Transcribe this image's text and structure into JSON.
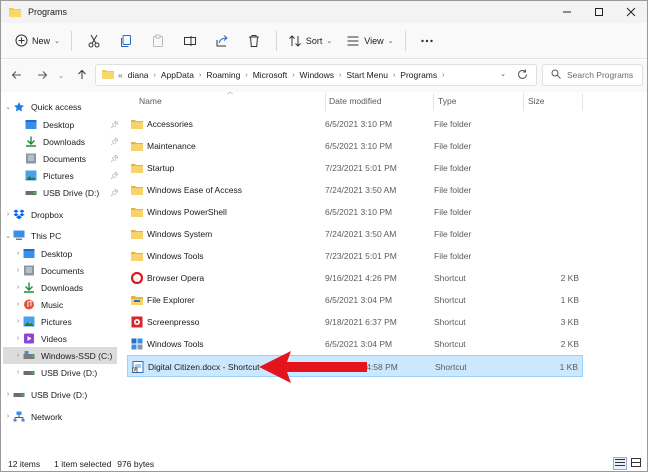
{
  "window": {
    "title": "Programs"
  },
  "toolbar": {
    "new_label": "New",
    "sort_label": "Sort",
    "view_label": "View",
    "more_icon": "ellipsis-icon",
    "icons": [
      "cut-icon",
      "copy-icon",
      "paste-icon",
      "rename-icon",
      "share-icon",
      "delete-icon"
    ]
  },
  "address": {
    "crumbs": [
      "diana",
      "AppData",
      "Roaming",
      "Microsoft",
      "Windows",
      "Start Menu",
      "Programs"
    ],
    "prefix": "«"
  },
  "search": {
    "placeholder": "Search Programs"
  },
  "nav": {
    "quick_access": "Quick access",
    "qa_items": [
      {
        "label": "Desktop",
        "icon": "desktop-icon",
        "pinned": true
      },
      {
        "label": "Downloads",
        "icon": "downloads-icon",
        "pinned": true
      },
      {
        "label": "Documents",
        "icon": "documents-icon",
        "pinned": true
      },
      {
        "label": "Pictures",
        "icon": "pictures-icon",
        "pinned": true
      },
      {
        "label": "USB Drive (D:)",
        "icon": "usb-drive-icon",
        "pinned": true
      }
    ],
    "dropbox": "Dropbox",
    "this_pc": "This PC",
    "pc_items": [
      {
        "label": "Desktop",
        "icon": "desktop-icon"
      },
      {
        "label": "Documents",
        "icon": "documents-icon"
      },
      {
        "label": "Downloads",
        "icon": "downloads-icon"
      },
      {
        "label": "Music",
        "icon": "music-icon"
      },
      {
        "label": "Pictures",
        "icon": "pictures-icon"
      },
      {
        "label": "Videos",
        "icon": "videos-icon"
      },
      {
        "label": "Windows-SSD (C:)",
        "icon": "drive-icon",
        "selected": true
      },
      {
        "label": "USB Drive (D:)",
        "icon": "usb-drive-icon"
      }
    ],
    "usb_root": "USB Drive (D:)",
    "network": "Network"
  },
  "columns": {
    "name": "Name",
    "date": "Date modified",
    "type": "Type",
    "size": "Size"
  },
  "files": [
    {
      "name": "Accessories",
      "date": "6/5/2021 3:10 PM",
      "type": "File folder",
      "size": "",
      "icon": "folder-icon"
    },
    {
      "name": "Maintenance",
      "date": "6/5/2021 3:10 PM",
      "type": "File folder",
      "size": "",
      "icon": "folder-icon"
    },
    {
      "name": "Startup",
      "date": "7/23/2021 5:01 PM",
      "type": "File folder",
      "size": "",
      "icon": "folder-icon"
    },
    {
      "name": "Windows Ease of Access",
      "date": "7/24/2021 3:50 AM",
      "type": "File folder",
      "size": "",
      "icon": "folder-icon"
    },
    {
      "name": "Windows PowerShell",
      "date": "6/5/2021 3:10 PM",
      "type": "File folder",
      "size": "",
      "icon": "folder-icon"
    },
    {
      "name": "Windows System",
      "date": "7/24/2021 3:50 AM",
      "type": "File folder",
      "size": "",
      "icon": "folder-icon"
    },
    {
      "name": "Windows Tools",
      "date": "7/23/2021 5:01 PM",
      "type": "File folder",
      "size": "",
      "icon": "folder-icon"
    },
    {
      "name": "Browser Opera",
      "date": "9/16/2021 4:26 PM",
      "type": "Shortcut",
      "size": "2 KB",
      "icon": "opera-icon"
    },
    {
      "name": "File Explorer",
      "date": "6/5/2021 3:04 PM",
      "type": "Shortcut",
      "size": "1 KB",
      "icon": "file-explorer-icon"
    },
    {
      "name": "Screenpresso",
      "date": "9/18/2021 6:37 PM",
      "type": "Shortcut",
      "size": "3 KB",
      "icon": "screenpresso-icon"
    },
    {
      "name": "Windows Tools",
      "date": "6/5/2021 3:04 PM",
      "type": "Shortcut",
      "size": "2 KB",
      "icon": "windows-tools-icon"
    },
    {
      "name": "Digital Citizen.docx - Shortcut",
      "date": "9/21/2021 4:58 PM",
      "type": "Shortcut",
      "size": "1 KB",
      "icon": "shortcut-icon",
      "selected": true
    }
  ],
  "status": {
    "items": "12 items",
    "selected": "1 item selected",
    "bytes": "976 bytes"
  },
  "colors": {
    "folder": "#f2c94c",
    "selection": "#cce8ff",
    "annotation": "#e3141b",
    "accent": "#0067c0"
  }
}
